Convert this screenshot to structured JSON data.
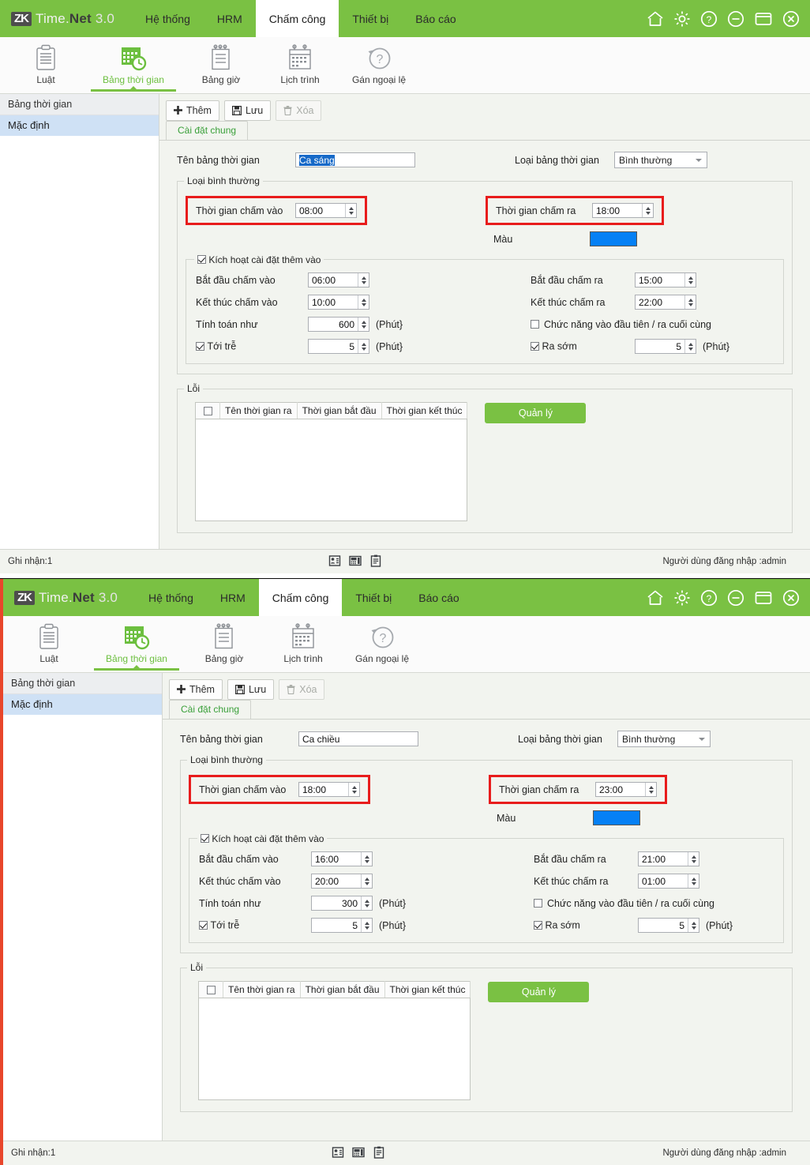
{
  "app": {
    "logo_mark": "ZK",
    "brand_pre": "Time.",
    "brand_bold": "Net",
    "brand_ver": "3.0",
    "accent_green": "#7ac143",
    "highlight_red": "#e81c1c",
    "color_swatch": "#0680f5"
  },
  "menu": {
    "items": [
      {
        "label": "Hệ thống",
        "active": false
      },
      {
        "label": "HRM",
        "active": false
      },
      {
        "label": "Chấm công",
        "active": true
      },
      {
        "label": "Thiết bị",
        "active": false
      },
      {
        "label": "Báo cáo",
        "active": false
      }
    ]
  },
  "window_controls": [
    {
      "name": "home-icon"
    },
    {
      "name": "gear-icon"
    },
    {
      "name": "help-icon"
    },
    {
      "name": "minimize-icon"
    },
    {
      "name": "maximize-icon"
    },
    {
      "name": "close-icon"
    }
  ],
  "ribbon": {
    "items": [
      {
        "label": "Luật",
        "icon": "clipboard-icon",
        "selected": false
      },
      {
        "label": "Bảng thời gian",
        "icon": "calendar-clock-icon",
        "selected": true
      },
      {
        "label": "Bảng giờ",
        "icon": "notepad-icon",
        "selected": false
      },
      {
        "label": "Lịch trình",
        "icon": "calendar-icon",
        "selected": false
      },
      {
        "label": "Gán ngoại lệ",
        "icon": "assign-exception-icon",
        "selected": false
      }
    ]
  },
  "sidebar": {
    "header": "Bảng thời gian",
    "items": [
      {
        "label": "Mặc định",
        "selected": true
      }
    ]
  },
  "toolbar": {
    "add_label": "Thêm",
    "save_label": "Lưu",
    "delete_label": "Xóa"
  },
  "tab": {
    "label": "Cài đặt chung"
  },
  "panels": [
    {
      "name_label": "Tên bảng thời gian",
      "name_value": "Ca sáng",
      "name_selected": true,
      "type_label": "Loại bảng thời gian",
      "type_value": "Bình thường",
      "normal_group_title": "Loại bình thường",
      "checkin_label": "Thời gian chấm vào",
      "checkin_value": "08:00",
      "checkout_label": "Thời gian chấm ra",
      "checkout_value": "18:00",
      "color_label": "Màu",
      "color_value": "#0680f5",
      "enable_extra_label": "Kích hoạt cài đặt thêm vào",
      "enable_extra_checked": true,
      "start_in_label": "Bắt đầu chấm vào",
      "start_in_value": "06:00",
      "end_in_label": "Kết thúc chấm vào",
      "end_in_value": "10:00",
      "calc_label": "Tính toán như",
      "calc_value": "600",
      "calc_unit": "(Phút}",
      "late_label": "Tới trễ",
      "late_checked": true,
      "late_value": "5",
      "late_unit": "(Phút}",
      "start_out_label": "Bắt đầu chấm ra",
      "start_out_value": "15:00",
      "end_out_label": "Kết thúc chấm ra",
      "end_out_value": "22:00",
      "firstlast_label": "Chức năng vào đầu tiên / ra cuối cùng",
      "firstlast_checked": false,
      "early_label": "Ra sớm",
      "early_checked": true,
      "early_value": "5",
      "early_unit": "(Phút}",
      "error_group_title": "Lỗi",
      "table_headers": [
        "Tên thời gian ra",
        "Thời gian bắt đầu",
        "Thời gian kết thúc"
      ],
      "manage_button": "Quản lý",
      "status_left": "Ghi nhận:1",
      "status_right": "Người dùng đăng nhập :admin"
    },
    {
      "name_label": "Tên bảng thời gian",
      "name_value": "Ca chiều",
      "name_selected": false,
      "type_label": "Loại bảng thời gian",
      "type_value": "Bình thường",
      "normal_group_title": "Loại bình thường",
      "checkin_label": "Thời gian chấm vào",
      "checkin_value": "18:00",
      "checkout_label": "Thời gian chấm ra",
      "checkout_value": "23:00",
      "color_label": "Màu",
      "color_value": "#0680f5",
      "enable_extra_label": "Kích hoạt cài đặt thêm vào",
      "enable_extra_checked": true,
      "start_in_label": "Bắt đầu chấm vào",
      "start_in_value": "16:00",
      "end_in_label": "Kết thúc chấm vào",
      "end_in_value": "20:00",
      "calc_label": "Tính toán như",
      "calc_value": "300",
      "calc_unit": "(Phút}",
      "late_label": "Tới trễ",
      "late_checked": true,
      "late_value": "5",
      "late_unit": "(Phút}",
      "start_out_label": "Bắt đầu chấm ra",
      "start_out_value": "21:00",
      "end_out_label": "Kết thúc chấm ra",
      "end_out_value": "01:00",
      "firstlast_label": "Chức năng vào đầu tiên / ra cuối cùng",
      "firstlast_checked": false,
      "early_label": "Ra sớm",
      "early_checked": true,
      "early_value": "5",
      "early_unit": "(Phút}",
      "error_group_title": "Lỗi",
      "table_headers": [
        "Tên thời gian ra",
        "Thời gian bắt đầu",
        "Thời gian kết thúc"
      ],
      "manage_button": "Quản lý",
      "status_left": "Ghi nhận:1",
      "status_right": "Người dùng đăng nhập :admin"
    }
  ],
  "status_icons": [
    {
      "name": "id-badge-icon"
    },
    {
      "name": "device-terminal-icon"
    },
    {
      "name": "clipboard-report-icon"
    }
  ]
}
